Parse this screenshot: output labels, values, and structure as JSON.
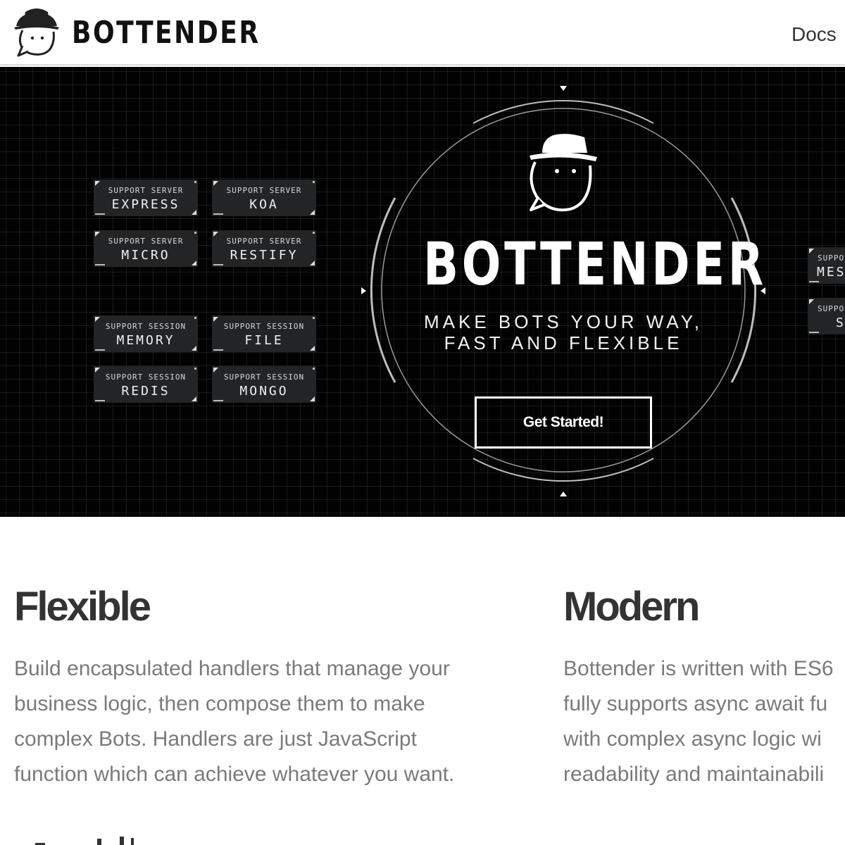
{
  "header": {
    "brand": "BOTTENDER",
    "logo_icon": "bot-hat-logo-icon",
    "nav": {
      "docs_label": "Docs"
    }
  },
  "hero": {
    "title": "BOTTENDER",
    "tagline_line1": "MAKE BOTS YOUR WAY,",
    "tagline_line2": "FAST AND FLEXIBLE",
    "cta_label": "Get Started!",
    "tags": [
      {
        "small": "SUPPORT SERVER",
        "big": "EXPRESS"
      },
      {
        "small": "SUPPORT SERVER",
        "big": "KOA"
      },
      {
        "small": "SUPPORT SERVER",
        "big": "MICRO"
      },
      {
        "small": "SUPPORT SERVER",
        "big": "RESTIFY"
      },
      {
        "small": "SUPPORT SESSION",
        "big": "MEMORY"
      },
      {
        "small": "SUPPORT SESSION",
        "big": "FILE"
      },
      {
        "small": "SUPPORT SESSION",
        "big": "REDIS"
      },
      {
        "small": "SUPPORT SESSION",
        "big": "MONGO"
      },
      {
        "small": "SUPPO",
        "big": "MES"
      },
      {
        "small": "SUPPO",
        "big": "S"
      }
    ],
    "colors": {
      "background": "#020202",
      "text": "#ffffff",
      "tag_bg": "#222426"
    }
  },
  "features": [
    {
      "title": "Flexible",
      "text": "Build encapsulated handlers that manage your\nbusiness logic, then compose them to make\ncomplex Bots. Handlers are just JavaScript\nfunction which can achieve whatever you want."
    },
    {
      "title": "Modern",
      "text": "Bottender is written with ES6\nfully supports async await fu\nwith complex async logic wi\nreadability and maintainabili"
    }
  ]
}
